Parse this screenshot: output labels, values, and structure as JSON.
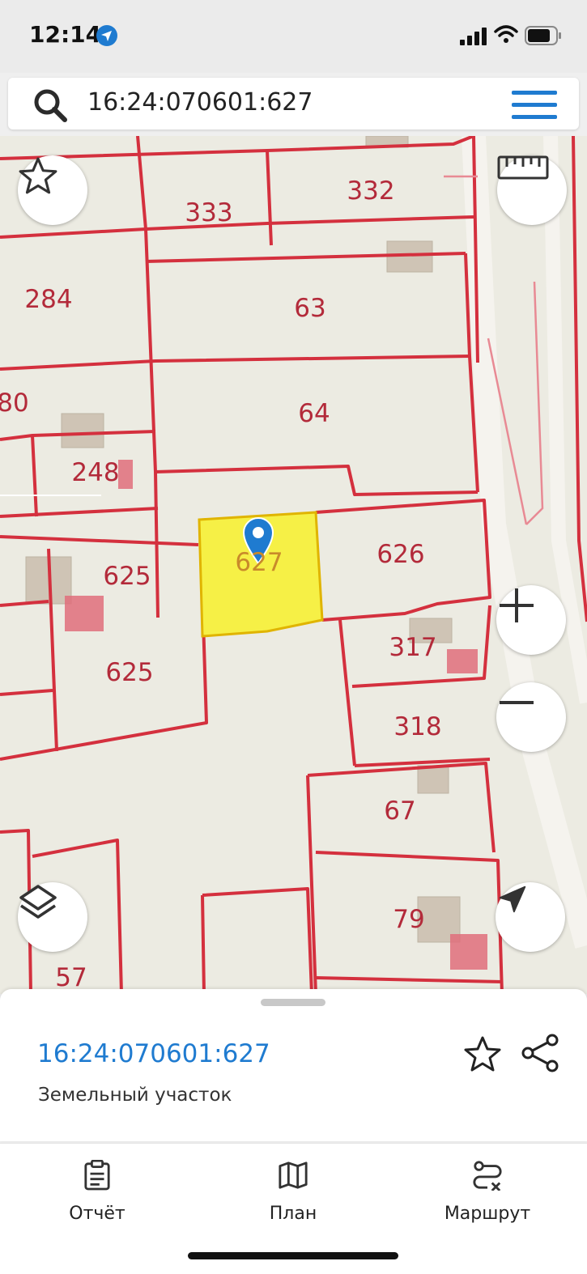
{
  "status_bar": {
    "time": "12:14",
    "icons": [
      "location-arrow-icon",
      "signal-icon",
      "wifi-icon",
      "battery-icon"
    ]
  },
  "search": {
    "query": "16:24:070601:627",
    "icons": [
      "search-icon",
      "menu-icon"
    ]
  },
  "map": {
    "parcel_labels": [
      "333",
      "332",
      "284",
      "63",
      "80",
      "64",
      "248",
      "627",
      "626",
      "625",
      "625",
      "317",
      "318",
      "67",
      "79",
      "57"
    ],
    "selected_parcel": "627",
    "colors": {
      "boundary": "#d4303e",
      "selected_fill": "#f6f046",
      "selected_border": "#e0b400",
      "building": "#cfc4b5",
      "building_pink": "#e06e7b",
      "background": "#ecebe2",
      "pin": "#1f7bd0"
    },
    "controls": [
      "favorite-star-icon",
      "ruler-icon",
      "zoom-in-icon",
      "zoom-out-icon",
      "layers-icon",
      "navigation-arrow-icon"
    ]
  },
  "info_panel": {
    "cadastral_number": "16:24:070601:627",
    "object_type": "Земельный участок",
    "icons": [
      "star-icon",
      "share-icon"
    ]
  },
  "bottom_nav": {
    "items": [
      {
        "label": "Отчёт",
        "icon": "report-clipboard-icon"
      },
      {
        "label": "План",
        "icon": "map-plan-icon"
      },
      {
        "label": "Маршрут",
        "icon": "route-icon"
      }
    ]
  }
}
